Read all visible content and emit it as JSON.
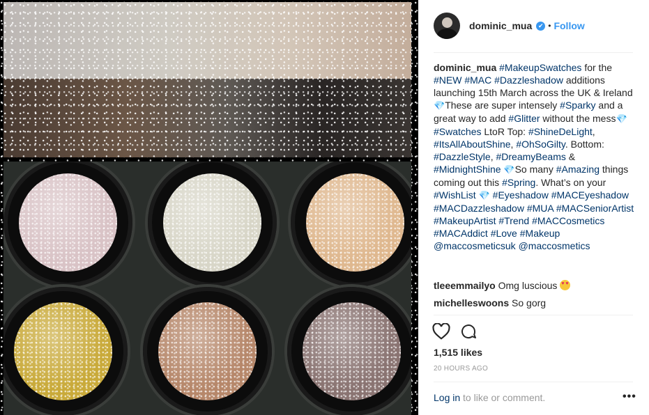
{
  "post": {
    "username": "dominic_mua",
    "verified_glyph": "✔",
    "separator": "•",
    "follow_label": "Follow",
    "caption_segments": [
      {
        "text": "dominic_mua",
        "kind": "user"
      },
      {
        "text": " ",
        "kind": "plain"
      },
      {
        "text": "#MakeupSwatches",
        "kind": "tag"
      },
      {
        "text": " for the ",
        "kind": "plain"
      },
      {
        "text": "#NEW",
        "kind": "tag"
      },
      {
        "text": " ",
        "kind": "plain"
      },
      {
        "text": "#MAC",
        "kind": "tag"
      },
      {
        "text": " ",
        "kind": "plain"
      },
      {
        "text": "#Dazzleshadow",
        "kind": "tag"
      },
      {
        "text": " additions launching 15th March across the UK & Ireland ",
        "kind": "plain"
      },
      {
        "text": "💎",
        "kind": "gem"
      },
      {
        "text": "These are super intensely ",
        "kind": "plain"
      },
      {
        "text": "#Sparky",
        "kind": "tag"
      },
      {
        "text": " and a great way to add ",
        "kind": "plain"
      },
      {
        "text": "#Glitter",
        "kind": "tag"
      },
      {
        "text": " without the mess",
        "kind": "plain"
      },
      {
        "text": "💎",
        "kind": "gem"
      },
      {
        "text": "#Swatches",
        "kind": "tag"
      },
      {
        "text": " LtoR Top: ",
        "kind": "plain"
      },
      {
        "text": "#ShineDeLight",
        "kind": "tag"
      },
      {
        "text": ", ",
        "kind": "plain"
      },
      {
        "text": "#ItsAllAboutShine",
        "kind": "tag"
      },
      {
        "text": ", ",
        "kind": "plain"
      },
      {
        "text": "#OhSoGilty",
        "kind": "tag"
      },
      {
        "text": ". Bottom: ",
        "kind": "plain"
      },
      {
        "text": "#DazzleStyle",
        "kind": "tag"
      },
      {
        "text": ", ",
        "kind": "plain"
      },
      {
        "text": "#DreamyBeams",
        "kind": "tag"
      },
      {
        "text": " & ",
        "kind": "plain"
      },
      {
        "text": "#MidnightShine",
        "kind": "tag"
      },
      {
        "text": " ",
        "kind": "plain"
      },
      {
        "text": "💎",
        "kind": "gem"
      },
      {
        "text": "So many ",
        "kind": "plain"
      },
      {
        "text": "#Amazing",
        "kind": "tag"
      },
      {
        "text": " things coming out this ",
        "kind": "plain"
      },
      {
        "text": "#Spring",
        "kind": "tag"
      },
      {
        "text": ". What’s on your ",
        "kind": "plain"
      },
      {
        "text": "#WishList",
        "kind": "tag"
      },
      {
        "text": " ",
        "kind": "plain"
      },
      {
        "text": "💎",
        "kind": "gem"
      },
      {
        "text": " ",
        "kind": "plain"
      },
      {
        "text": "#Eyeshadow",
        "kind": "tag"
      },
      {
        "text": " ",
        "kind": "plain"
      },
      {
        "text": "#MACEyeshadow",
        "kind": "tag"
      },
      {
        "text": " ",
        "kind": "plain"
      },
      {
        "text": "#MACDazzleshadow",
        "kind": "tag"
      },
      {
        "text": " ",
        "kind": "plain"
      },
      {
        "text": "#MUA",
        "kind": "tag"
      },
      {
        "text": " ",
        "kind": "plain"
      },
      {
        "text": "#MACSeniorArtist",
        "kind": "tag"
      },
      {
        "text": " ",
        "kind": "plain"
      },
      {
        "text": "#MakeupArtist",
        "kind": "tag"
      },
      {
        "text": " ",
        "kind": "plain"
      },
      {
        "text": "#Trend",
        "kind": "tag"
      },
      {
        "text": " ",
        "kind": "plain"
      },
      {
        "text": "#MACCosmetics",
        "kind": "tag"
      },
      {
        "text": " ",
        "kind": "plain"
      },
      {
        "text": "#MACAddict",
        "kind": "tag"
      },
      {
        "text": " ",
        "kind": "plain"
      },
      {
        "text": "#Love",
        "kind": "tag"
      },
      {
        "text": " ",
        "kind": "plain"
      },
      {
        "text": "#Makeup",
        "kind": "tag"
      },
      {
        "text": " ",
        "kind": "plain"
      },
      {
        "text": "@maccosmeticsuk",
        "kind": "tag"
      },
      {
        "text": " ",
        "kind": "plain"
      },
      {
        "text": "@maccosmetics",
        "kind": "tag"
      }
    ],
    "comments": [
      {
        "user": "tleeemmailyo",
        "text": "Omg luscious ",
        "emoji": "heart-eyes"
      },
      {
        "user": "michelleswoons",
        "text": "So gorg"
      }
    ],
    "likes": "1,515 likes",
    "time": "20 HOURS AGO",
    "login_link": "Log in",
    "login_rest": " to like or comment.",
    "more_label": "•••"
  },
  "icons": {
    "like": "heart-outline-icon",
    "comment": "speech-bubble-icon",
    "verified": "verified-badge-icon",
    "more": "more-options-icon"
  },
  "colors": {
    "link": "#003569",
    "accent": "#3897f0",
    "muted": "#999999",
    "text": "#262626"
  },
  "swatches": [
    {
      "color": "#d9c3c6"
    },
    {
      "color": "#d8d6c8"
    },
    {
      "color": "#dfb88f"
    },
    {
      "color": "#c9aa3a"
    },
    {
      "color": "#b6876a"
    },
    {
      "color": "#8a7472"
    }
  ]
}
